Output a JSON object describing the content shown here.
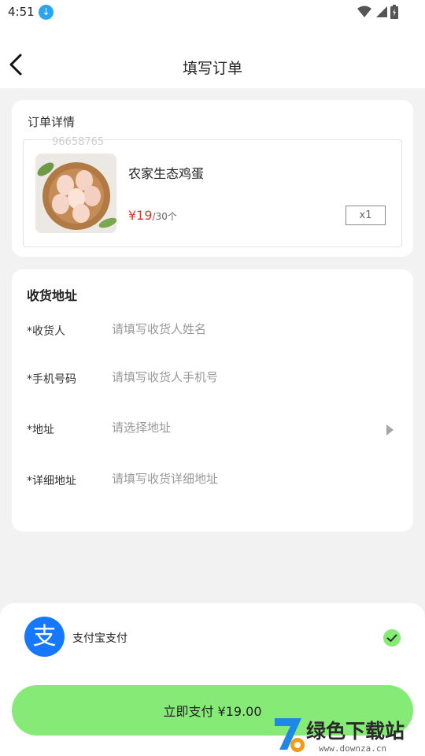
{
  "status_bar": {
    "time": "4:51",
    "download_icon": "download-circle-icon",
    "icons": [
      "wifi-icon",
      "signal-icon",
      "battery-icon"
    ]
  },
  "header": {
    "title": "填写订单",
    "back_icon": "chevron-left-icon"
  },
  "order_details": {
    "title": "订单详情",
    "watermark_id": "96658765",
    "product": {
      "name": "农家生态鸡蛋",
      "price": "¥19",
      "unit": "/30个",
      "quantity": "x1",
      "image": "eggs-in-wooden-bowl"
    }
  },
  "address": {
    "title": "收货地址",
    "fields": [
      {
        "label": "*收货人",
        "placeholder": "请填写收货人姓名",
        "value": ""
      },
      {
        "label": "*手机号码",
        "placeholder": "请填写收货人手机号",
        "value": ""
      },
      {
        "label": "*地址",
        "placeholder": "请选择地址",
        "value": ""
      },
      {
        "label": "*详细地址",
        "placeholder": "请填写收货详细地址",
        "value": ""
      }
    ],
    "select_icon": "triangle-right-icon"
  },
  "payment": {
    "method_label": "支付宝支付",
    "method_icon": "alipay-logo",
    "logo_glyph": "支",
    "selected_icon": "check-circle-icon",
    "selected": true,
    "pay_button_label": "立即支付 ¥19.00"
  },
  "watermark": {
    "text": "绿色下载站",
    "url": "www.downza.cn"
  },
  "colors": {
    "accent": "#86ea76",
    "price": "#e0362d",
    "alipay": "#1677ff",
    "background": "#f2f2f2"
  }
}
